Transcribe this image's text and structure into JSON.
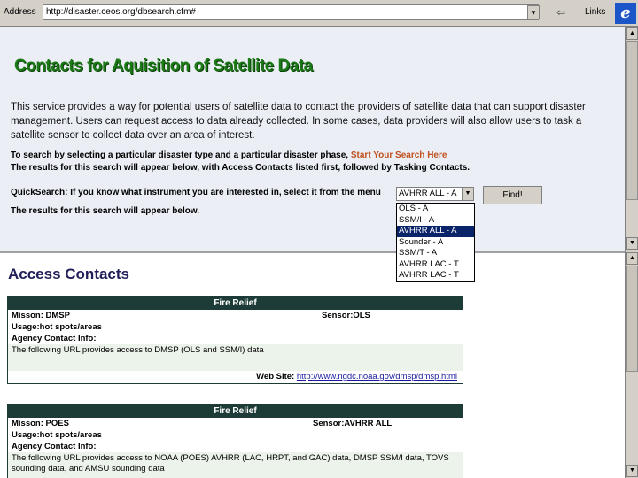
{
  "addressbar": {
    "label": "Address",
    "url": "http://disaster.ceos.org/dbsearch.cfm#",
    "go_icon": "arrow-right-icon",
    "links_label": "Links",
    "logo": "ie-logo"
  },
  "top": {
    "title": "Contacts for Aquisition of Satellite Data",
    "intro": "This service provides a way for potential users of satellite data to contact the providers of satellite data that can support disaster management. Users can request access to data already collected. In some cases, data providers will also allow users to task a satellite sensor to collect data over an area of interest.",
    "search_lead": "To search by selecting a particular disaster type and a particular disaster phase, ",
    "start_link": "Start Your Search Here",
    "results_order": "The results for this search will appear below, with Access Contacts listed first, followed by Tasking Contacts.",
    "quicksearch_label": "QuickSearch: If you know what instrument you are interested in, select it from the menu",
    "quicksearch_value": "AVHRR ALL - A",
    "find_label": "Find!",
    "results_note": "The results for this search will appear below."
  },
  "dropdown": {
    "options": [
      "OLS - A",
      "SSM/I - A",
      "AVHRR ALL - A",
      "Sounder - A",
      "SSM/T - A",
      "AVHRR LAC - T",
      "AVHRR LAC - T"
    ],
    "selected_index": 2
  },
  "bottom": {
    "heading": "Access Contacts",
    "cards": [
      {
        "header": "Fire Relief",
        "mission": "Misson: DMSP",
        "sensor": "Sensor:OLS",
        "usage": "Usage:hot spots/areas",
        "contact_label": "Agency Contact Info:",
        "text": "The following URL provides access to DMSP (OLS and SSM/I) data",
        "web_label": "Web Site: ",
        "web_url": "http://www.ngdc.noaa.gov/dmsp/dmsp.html"
      },
      {
        "header": "Fire Relief",
        "mission": "Misson: POES",
        "sensor": "Sensor:AVHRR ALL",
        "usage": "Usage:hot spots/areas",
        "contact_label": "Agency Contact Info:",
        "text": "The following URL provides access to NOAA (POES) AVHRR (LAC, HRPT, and GAC) data, DMSP SSM/I data, TOVS sounding data, and AMSU sounding data"
      }
    ]
  }
}
